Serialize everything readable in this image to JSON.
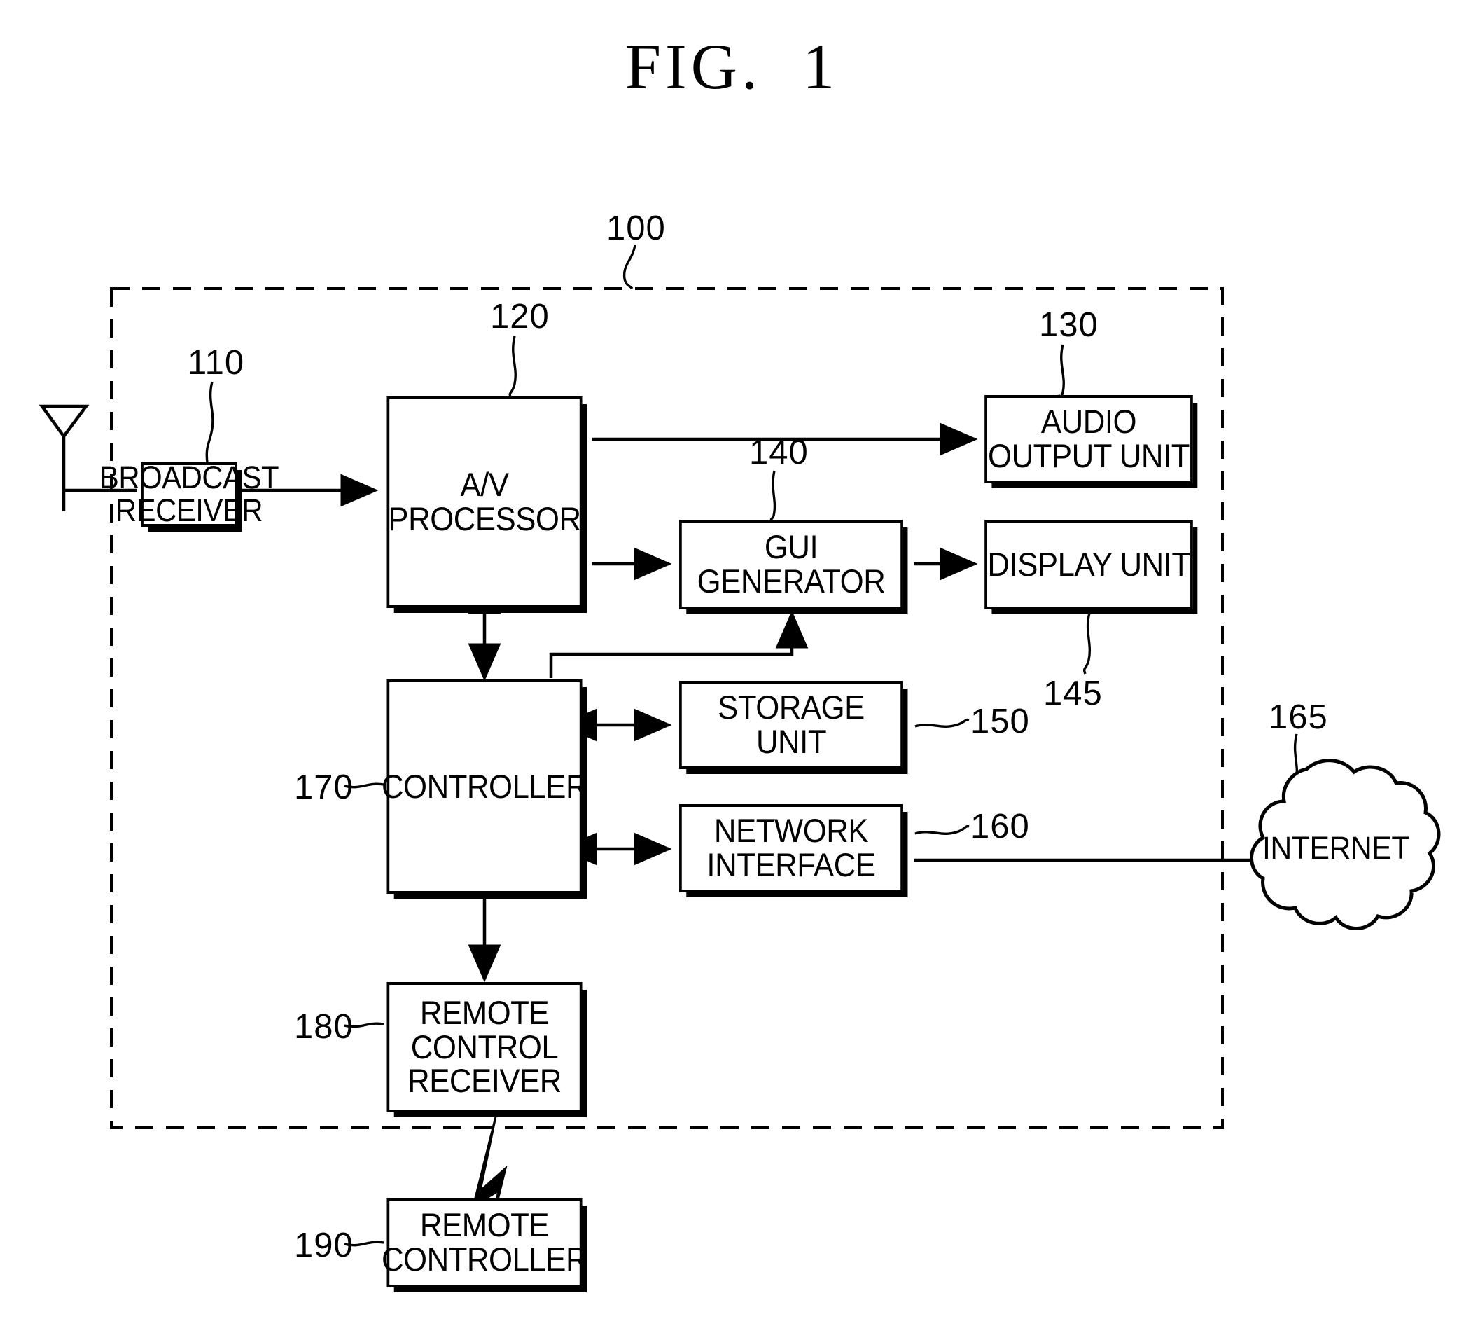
{
  "figure": {
    "title": "FIG.  1"
  },
  "system": {
    "ref": "100",
    "boundary": "dashed-enclosure"
  },
  "blocks": [
    {
      "id": "broadcast-receiver",
      "ref": "110",
      "label": "BROADCAST\nRECEIVER"
    },
    {
      "id": "av-processor",
      "ref": "120",
      "label": "A/V\nPROCESSOR"
    },
    {
      "id": "audio-output-unit",
      "ref": "130",
      "label": "AUDIO\nOUTPUT UNIT"
    },
    {
      "id": "gui-generator",
      "ref": "140",
      "label": "GUI\nGENERATOR"
    },
    {
      "id": "display-unit",
      "ref": "145",
      "label": "DISPLAY UNIT"
    },
    {
      "id": "storage-unit",
      "ref": "150",
      "label": "STORAGE UNIT"
    },
    {
      "id": "network-interface",
      "ref": "160",
      "label": "NETWORK\nINTERFACE"
    },
    {
      "id": "internet-cloud",
      "ref": "165",
      "label": "INTERNET"
    },
    {
      "id": "controller",
      "ref": "170",
      "label": "CONTROLLER"
    },
    {
      "id": "remote-control-receiver",
      "ref": "180",
      "label": "REMOTE\nCONTROL\nRECEIVER"
    },
    {
      "id": "remote-controller",
      "ref": "190",
      "label": "REMOTE\nCONTROLLER"
    }
  ],
  "icons": {
    "antenna": "antenna-icon",
    "wireless_link": "lightning-bolt-icon",
    "cloud": "cloud-icon"
  },
  "colors": {
    "stroke": "#000000",
    "background": "#ffffff"
  },
  "connections": [
    {
      "from": "antenna",
      "to": "broadcast-receiver",
      "type": "line"
    },
    {
      "from": "broadcast-receiver",
      "to": "av-processor",
      "type": "arrow"
    },
    {
      "from": "av-processor",
      "to": "audio-output-unit",
      "type": "arrow"
    },
    {
      "from": "av-processor",
      "to": "gui-generator",
      "type": "arrow"
    },
    {
      "from": "gui-generator",
      "to": "display-unit",
      "type": "arrow"
    },
    {
      "from": "av-processor",
      "to": "controller",
      "type": "double-arrow"
    },
    {
      "from": "controller",
      "to": "gui-generator",
      "type": "arrow"
    },
    {
      "from": "controller",
      "to": "storage-unit",
      "type": "double-arrow"
    },
    {
      "from": "controller",
      "to": "network-interface",
      "type": "double-arrow"
    },
    {
      "from": "network-interface",
      "to": "internet-cloud",
      "type": "line"
    },
    {
      "from": "controller",
      "to": "remote-control-receiver",
      "type": "double-arrow"
    },
    {
      "from": "remote-controller",
      "to": "remote-control-receiver",
      "type": "wireless"
    }
  ]
}
